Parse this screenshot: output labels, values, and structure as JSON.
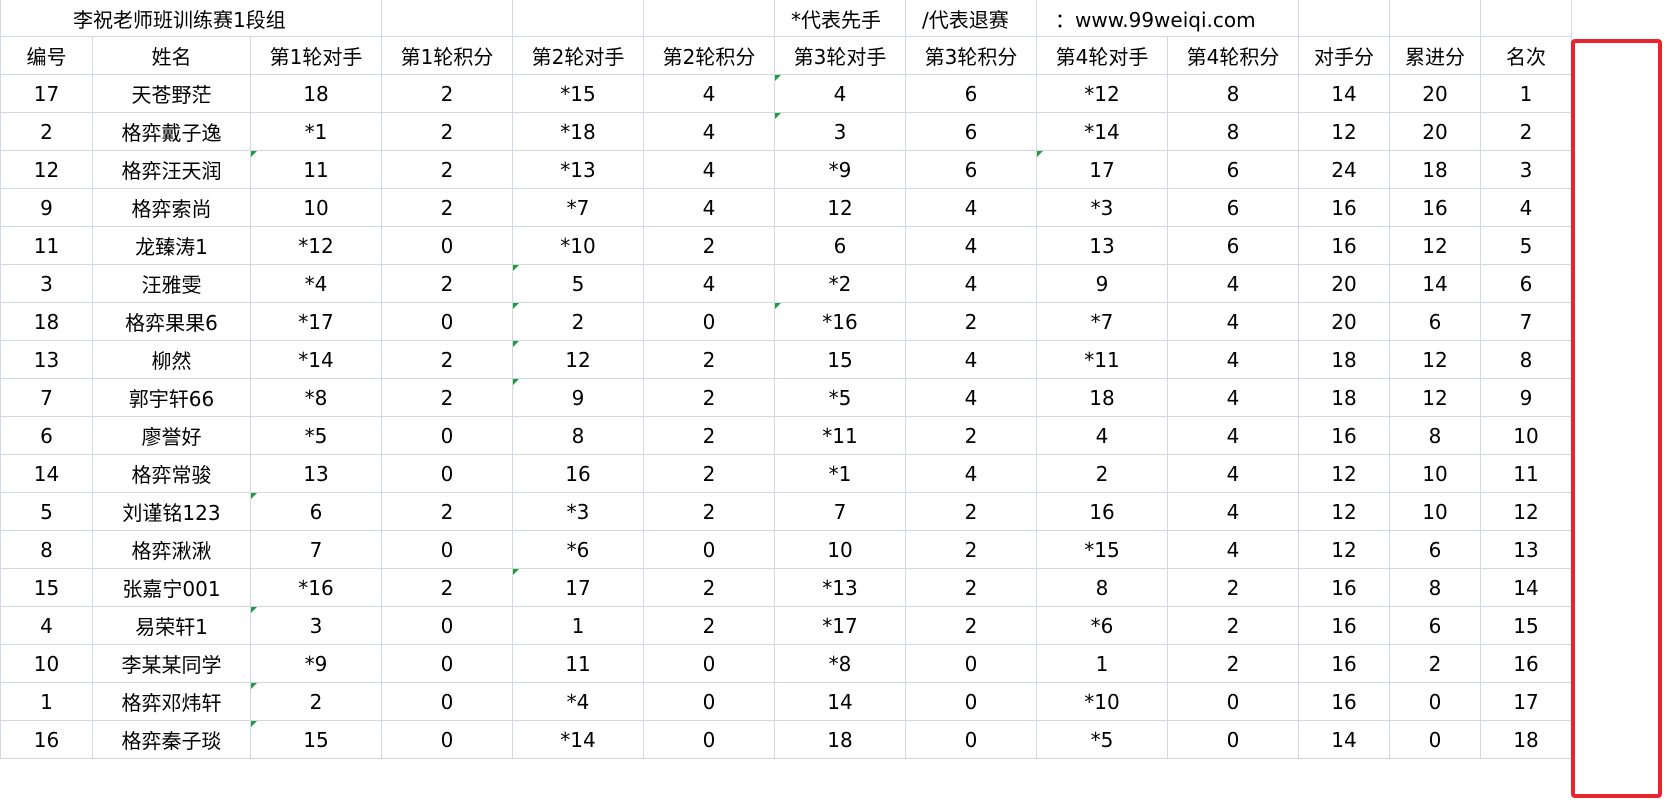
{
  "sheet": {
    "title": "李祝老师班训练赛1段组",
    "note_black": "*代表先手",
    "note_withdraw": "/代表退赛",
    "website": "：www.99weiqi.com"
  },
  "headers": [
    "编号",
    "姓名",
    "第1轮对手",
    "第1轮积分",
    "第2轮对手",
    "第2轮积分",
    "第3轮对手",
    "第3轮积分",
    "第4轮对手",
    "第4轮积分",
    "对手分",
    "累进分",
    "名次"
  ],
  "rows": [
    [
      "17",
      "天苍野茫",
      "18",
      "2",
      "*15",
      "4",
      "4",
      "6",
      "*12",
      "8",
      "14",
      "20",
      "1"
    ],
    [
      "2",
      "格弈戴子逸",
      "*1",
      "2",
      "*18",
      "4",
      "3",
      "6",
      "*14",
      "8",
      "12",
      "20",
      "2"
    ],
    [
      "12",
      "格弈汪天润",
      "11",
      "2",
      "*13",
      "4",
      "*9",
      "6",
      "17",
      "6",
      "24",
      "18",
      "3"
    ],
    [
      "9",
      "格弈索尚",
      "10",
      "2",
      "*7",
      "4",
      "12",
      "4",
      "*3",
      "6",
      "16",
      "16",
      "4"
    ],
    [
      "11",
      "龙臻涛1",
      "*12",
      "0",
      "*10",
      "2",
      "6",
      "4",
      "13",
      "6",
      "16",
      "12",
      "5"
    ],
    [
      "3",
      "汪雅雯",
      "*4",
      "2",
      "5",
      "4",
      "*2",
      "4",
      "9",
      "4",
      "20",
      "14",
      "6"
    ],
    [
      "18",
      "格弈果果6",
      "*17",
      "0",
      "2",
      "0",
      "*16",
      "2",
      "*7",
      "4",
      "20",
      "6",
      "7"
    ],
    [
      "13",
      "柳然",
      "*14",
      "2",
      "12",
      "2",
      "15",
      "4",
      "*11",
      "4",
      "18",
      "12",
      "8"
    ],
    [
      "7",
      "郭宇轩66",
      "*8",
      "2",
      "9",
      "2",
      "*5",
      "4",
      "18",
      "4",
      "18",
      "12",
      "9"
    ],
    [
      "6",
      "廖誉好",
      "*5",
      "0",
      "8",
      "2",
      "*11",
      "2",
      "4",
      "4",
      "16",
      "8",
      "10"
    ],
    [
      "14",
      "格弈常骏",
      "13",
      "0",
      "16",
      "2",
      "*1",
      "4",
      "2",
      "4",
      "12",
      "10",
      "11"
    ],
    [
      "5",
      "刘谨铭123",
      "6",
      "2",
      "*3",
      "2",
      "7",
      "2",
      "16",
      "4",
      "12",
      "10",
      "12"
    ],
    [
      "8",
      "格弈湫湫",
      "7",
      "0",
      "*6",
      "0",
      "10",
      "2",
      "*15",
      "4",
      "12",
      "6",
      "13"
    ],
    [
      "15",
      "张嘉宁001",
      "*16",
      "2",
      "17",
      "2",
      "*13",
      "2",
      "8",
      "2",
      "16",
      "8",
      "14"
    ],
    [
      "4",
      "易荣轩1",
      "3",
      "0",
      "1",
      "2",
      "*17",
      "2",
      "*6",
      "2",
      "16",
      "6",
      "15"
    ],
    [
      "10",
      "李某某同学",
      "*9",
      "0",
      "11",
      "0",
      "*8",
      "0",
      "1",
      "2",
      "16",
      "2",
      "16"
    ],
    [
      "1",
      "格弈邓炜轩",
      "2",
      "0",
      "*4",
      "0",
      "14",
      "0",
      "*10",
      "0",
      "16",
      "0",
      "17"
    ],
    [
      "16",
      "格弈秦子琰",
      "15",
      "0",
      "*14",
      "0",
      "18",
      "0",
      "*5",
      "0",
      "14",
      "0",
      "18"
    ]
  ],
  "colors": {
    "grid": "#d3d6e4",
    "highlight_border": "#e8242e",
    "comment_marker": "#1f9d3a"
  }
}
